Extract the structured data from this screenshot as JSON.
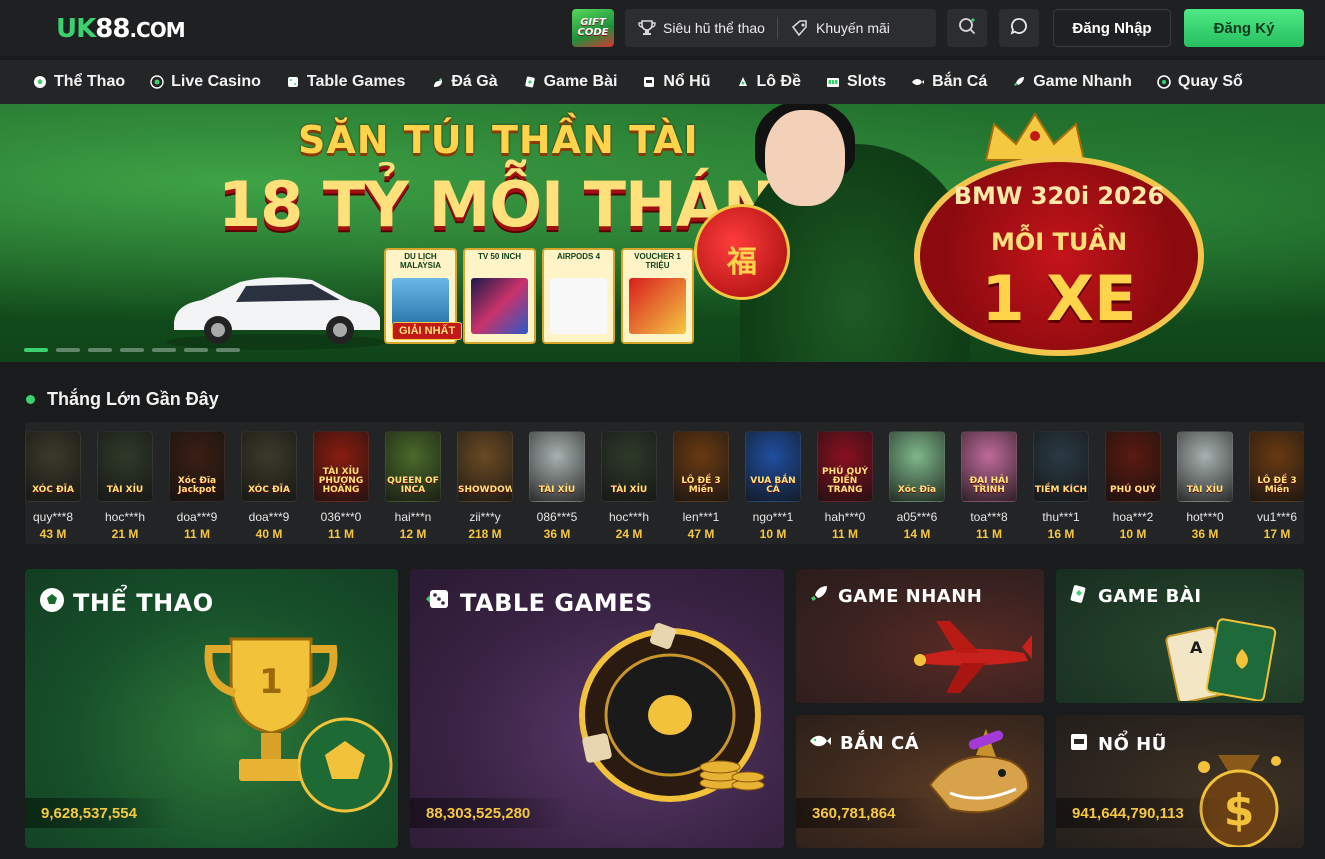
{
  "header": {
    "logo_uk": "UK",
    "logo_num": "88",
    "logo_dom": ".COM",
    "giftcode_line1": "GIFT",
    "giftcode_line2": "CODE",
    "pill_sports_jackpot": "Siêu hũ thể thao",
    "pill_promotions": "Khuyến mãi",
    "login_label": "Đăng Nhập",
    "register_label": "Đăng Ký"
  },
  "nav": {
    "items": [
      {
        "label": "Thể Thao",
        "icon": "soccer-ball-icon"
      },
      {
        "label": "Live Casino",
        "icon": "casino-chip-icon"
      },
      {
        "label": "Table Games",
        "icon": "dice-icon"
      },
      {
        "label": "Đá Gà",
        "icon": "rooster-icon"
      },
      {
        "label": "Game Bài",
        "icon": "cards-icon"
      },
      {
        "label": "Nổ Hũ",
        "icon": "slot-machine-icon"
      },
      {
        "label": "Lô Đề",
        "icon": "lottery-icon"
      },
      {
        "label": "Slots",
        "icon": "slots-icon"
      },
      {
        "label": "Bắn Cá",
        "icon": "fish-icon"
      },
      {
        "label": "Game Nhanh",
        "icon": "rocket-icon"
      },
      {
        "label": "Quay Số",
        "icon": "lottery-wheel-icon"
      }
    ]
  },
  "banner": {
    "title1": "SĂN TÚI THẦN TÀI",
    "title2": "18 TỶ MỖI THÁNG",
    "prizes": [
      {
        "label": "DU LỊCH MALAYSIA"
      },
      {
        "label": "TV 50 INCH"
      },
      {
        "label": "AIRPODS 4"
      },
      {
        "label": "VOUCHER 1 TRIỆU"
      }
    ],
    "prize_ribbon": "GIẢI NHẤT",
    "bag_char": "福",
    "badge_line1": "BMW 320i 2026",
    "badge_line2": "MỖI TUẦN",
    "badge_line3": "1 XE",
    "dots_total": 7,
    "dots_active": 0
  },
  "recent_wins": {
    "title": "Thắng Lớn Gần Đây",
    "items": [
      {
        "game": "XÓC ĐĨA",
        "user": "quy***8",
        "amount": "43 M",
        "color": "#3b3a2a"
      },
      {
        "game": "TÀI XỈU",
        "user": "hoc***h",
        "amount": "21 M",
        "color": "#2f3a2a"
      },
      {
        "game": "Xóc Đĩa Jackpot",
        "user": "doa***9",
        "amount": "11 M",
        "color": "#3a1e14"
      },
      {
        "game": "XÓC ĐĨA",
        "user": "doa***9",
        "amount": "40 M",
        "color": "#3b3a2a"
      },
      {
        "game": "TÀI XỈU PHƯỢNG HOÀNG",
        "user": "036***0",
        "amount": "11 M",
        "color": "#8a1c10"
      },
      {
        "game": "QUEEN OF INCA",
        "user": "hai***n",
        "amount": "12 M",
        "color": "#4a6a2a"
      },
      {
        "game": "SHOWDOWN",
        "user": "zii***y",
        "amount": "218 M",
        "color": "#6a4a24"
      },
      {
        "game": "TÀI XỈU",
        "user": "086***5",
        "amount": "36 M",
        "color": "#a8b2b0"
      },
      {
        "game": "TÀI XỈU",
        "user": "hoc***h",
        "amount": "24 M",
        "color": "#2f3a2a"
      },
      {
        "game": "LÔ ĐỀ 3 Miền",
        "user": "len***1",
        "amount": "47 M",
        "color": "#6a3a12"
      },
      {
        "game": "VUA BẮN CÁ",
        "user": "ngo***1",
        "amount": "10 M",
        "color": "#1f4fa0"
      },
      {
        "game": "PHÚ QUÝ ĐIỀN TRANG",
        "user": "hah***0",
        "amount": "11 M",
        "color": "#8a1020"
      },
      {
        "game": "Xóc Đĩa",
        "user": "a05***6",
        "amount": "14 M",
        "color": "#7fb88a"
      },
      {
        "game": "ĐẠI HẢI TRÌNH",
        "user": "toa***8",
        "amount": "11 M",
        "color": "#c06a9a"
      },
      {
        "game": "TIỀM KÍCH",
        "user": "thu***1",
        "amount": "16 M",
        "color": "#2a3a44"
      },
      {
        "game": "PHÚ QUÝ",
        "user": "hoa***2",
        "amount": "10 M",
        "color": "#5a1a10"
      },
      {
        "game": "TÀI XỈU",
        "user": "hot***0",
        "amount": "36 M",
        "color": "#a8b2b0"
      },
      {
        "game": "LÔ ĐỀ 3 Miền",
        "user": "vu1***6",
        "amount": "17 M",
        "color": "#6a3a12"
      }
    ]
  },
  "tiles": {
    "sports": {
      "title": "THỂ THAO",
      "jackpot": "9,628,537,554",
      "icon": "soccer-ball-icon"
    },
    "table_games": {
      "title": "TABLE GAMES",
      "jackpot": "88,303,525,280",
      "icon": "dice-icon"
    },
    "fast_games": {
      "title": "GAME NHANH",
      "icon": "rocket-icon"
    },
    "card_games": {
      "title": "GAME BÀI",
      "icon": "cards-icon"
    },
    "fishing": {
      "title": "BẮN CÁ",
      "jackpot": "360,781,864",
      "icon": "fish-icon"
    },
    "slots": {
      "title": "NỔ HŨ",
      "jackpot": "941,644,790,113",
      "icon": "slot-machine-icon"
    }
  }
}
